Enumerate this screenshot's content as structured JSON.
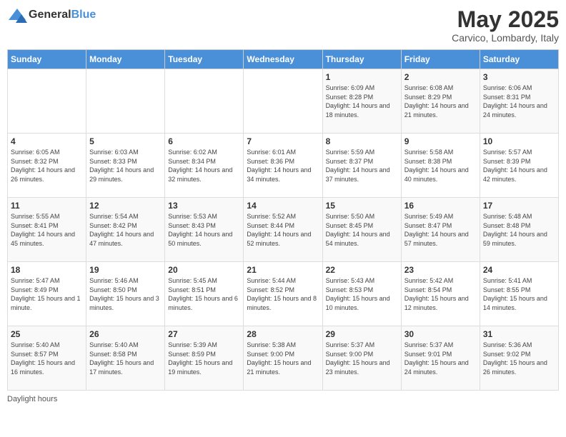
{
  "logo": {
    "general": "General",
    "blue": "Blue"
  },
  "header": {
    "month": "May 2025",
    "location": "Carvico, Lombardy, Italy"
  },
  "days_of_week": [
    "Sunday",
    "Monday",
    "Tuesday",
    "Wednesday",
    "Thursday",
    "Friday",
    "Saturday"
  ],
  "weeks": [
    [
      {
        "day": "",
        "info": ""
      },
      {
        "day": "",
        "info": ""
      },
      {
        "day": "",
        "info": ""
      },
      {
        "day": "",
        "info": ""
      },
      {
        "day": "1",
        "info": "Sunrise: 6:09 AM\nSunset: 8:28 PM\nDaylight: 14 hours and 18 minutes."
      },
      {
        "day": "2",
        "info": "Sunrise: 6:08 AM\nSunset: 8:29 PM\nDaylight: 14 hours and 21 minutes."
      },
      {
        "day": "3",
        "info": "Sunrise: 6:06 AM\nSunset: 8:31 PM\nDaylight: 14 hours and 24 minutes."
      }
    ],
    [
      {
        "day": "4",
        "info": "Sunrise: 6:05 AM\nSunset: 8:32 PM\nDaylight: 14 hours and 26 minutes."
      },
      {
        "day": "5",
        "info": "Sunrise: 6:03 AM\nSunset: 8:33 PM\nDaylight: 14 hours and 29 minutes."
      },
      {
        "day": "6",
        "info": "Sunrise: 6:02 AM\nSunset: 8:34 PM\nDaylight: 14 hours and 32 minutes."
      },
      {
        "day": "7",
        "info": "Sunrise: 6:01 AM\nSunset: 8:36 PM\nDaylight: 14 hours and 34 minutes."
      },
      {
        "day": "8",
        "info": "Sunrise: 5:59 AM\nSunset: 8:37 PM\nDaylight: 14 hours and 37 minutes."
      },
      {
        "day": "9",
        "info": "Sunrise: 5:58 AM\nSunset: 8:38 PM\nDaylight: 14 hours and 40 minutes."
      },
      {
        "day": "10",
        "info": "Sunrise: 5:57 AM\nSunset: 8:39 PM\nDaylight: 14 hours and 42 minutes."
      }
    ],
    [
      {
        "day": "11",
        "info": "Sunrise: 5:55 AM\nSunset: 8:41 PM\nDaylight: 14 hours and 45 minutes."
      },
      {
        "day": "12",
        "info": "Sunrise: 5:54 AM\nSunset: 8:42 PM\nDaylight: 14 hours and 47 minutes."
      },
      {
        "day": "13",
        "info": "Sunrise: 5:53 AM\nSunset: 8:43 PM\nDaylight: 14 hours and 50 minutes."
      },
      {
        "day": "14",
        "info": "Sunrise: 5:52 AM\nSunset: 8:44 PM\nDaylight: 14 hours and 52 minutes."
      },
      {
        "day": "15",
        "info": "Sunrise: 5:50 AM\nSunset: 8:45 PM\nDaylight: 14 hours and 54 minutes."
      },
      {
        "day": "16",
        "info": "Sunrise: 5:49 AM\nSunset: 8:47 PM\nDaylight: 14 hours and 57 minutes."
      },
      {
        "day": "17",
        "info": "Sunrise: 5:48 AM\nSunset: 8:48 PM\nDaylight: 14 hours and 59 minutes."
      }
    ],
    [
      {
        "day": "18",
        "info": "Sunrise: 5:47 AM\nSunset: 8:49 PM\nDaylight: 15 hours and 1 minute."
      },
      {
        "day": "19",
        "info": "Sunrise: 5:46 AM\nSunset: 8:50 PM\nDaylight: 15 hours and 3 minutes."
      },
      {
        "day": "20",
        "info": "Sunrise: 5:45 AM\nSunset: 8:51 PM\nDaylight: 15 hours and 6 minutes."
      },
      {
        "day": "21",
        "info": "Sunrise: 5:44 AM\nSunset: 8:52 PM\nDaylight: 15 hours and 8 minutes."
      },
      {
        "day": "22",
        "info": "Sunrise: 5:43 AM\nSunset: 8:53 PM\nDaylight: 15 hours and 10 minutes."
      },
      {
        "day": "23",
        "info": "Sunrise: 5:42 AM\nSunset: 8:54 PM\nDaylight: 15 hours and 12 minutes."
      },
      {
        "day": "24",
        "info": "Sunrise: 5:41 AM\nSunset: 8:55 PM\nDaylight: 15 hours and 14 minutes."
      }
    ],
    [
      {
        "day": "25",
        "info": "Sunrise: 5:40 AM\nSunset: 8:57 PM\nDaylight: 15 hours and 16 minutes."
      },
      {
        "day": "26",
        "info": "Sunrise: 5:40 AM\nSunset: 8:58 PM\nDaylight: 15 hours and 17 minutes."
      },
      {
        "day": "27",
        "info": "Sunrise: 5:39 AM\nSunset: 8:59 PM\nDaylight: 15 hours and 19 minutes."
      },
      {
        "day": "28",
        "info": "Sunrise: 5:38 AM\nSunset: 9:00 PM\nDaylight: 15 hours and 21 minutes."
      },
      {
        "day": "29",
        "info": "Sunrise: 5:37 AM\nSunset: 9:00 PM\nDaylight: 15 hours and 23 minutes."
      },
      {
        "day": "30",
        "info": "Sunrise: 5:37 AM\nSunset: 9:01 PM\nDaylight: 15 hours and 24 minutes."
      },
      {
        "day": "31",
        "info": "Sunrise: 5:36 AM\nSunset: 9:02 PM\nDaylight: 15 hours and 26 minutes."
      }
    ]
  ],
  "footer": {
    "note": "Daylight hours"
  }
}
